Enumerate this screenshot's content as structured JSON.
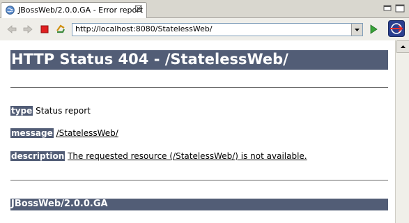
{
  "tab": {
    "title": "JBossWeb/2.0.0.GA - Error report",
    "close_glyph": "☒"
  },
  "toolbar": {
    "url": "http://localhost:8080/StatelessWeb/"
  },
  "page": {
    "heading": "HTTP Status 404 - /StatelessWeb/",
    "type_label": "type",
    "type_value": "Status report",
    "message_label": "message",
    "message_value": "/StatelessWeb/",
    "description_label": "description",
    "description_value": "The requested resource (/StatelessWeb/) is not available.",
    "footer": "JBossWeb/2.0.0.GA"
  },
  "colors": {
    "accent": "#525d76"
  }
}
